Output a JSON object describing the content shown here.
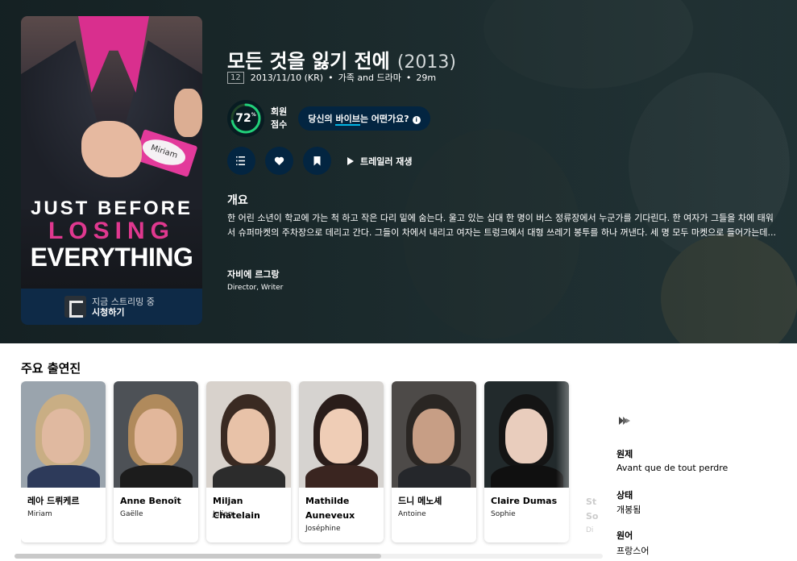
{
  "hero": {
    "title": "모든 것을 잃기 전에",
    "year": "(2013)",
    "certification": "12",
    "release_date": "2013/11/10 (KR)",
    "genres": "가족 and 드라마",
    "runtime": "29m",
    "user_score": "72",
    "user_score_percent": 72,
    "user_score_unit": "%",
    "score_label_line1": "회원",
    "score_label_line2": "점수",
    "vibe_prompt_prefix": "당신의 ",
    "vibe_prompt_highlight": "바이브",
    "vibe_prompt_suffix": "는 어떤가요?",
    "play_trailer": "트레일러 재생",
    "overview_heading": "개요",
    "overview": "한 어린 소년이 학교에 가는 척 하고 작은 다리 밑에 숨는다. 울고 있는 십대 한 명이 버스 정류장에서 누군가를 기다린다. 한 여자가 그들을 차에 태워서 슈퍼마켓의 주차장으로 데리고 간다. 그들이 차에서 내리고 여자는 트렁크에서 대형 쓰레기 봉투를 하나 꺼낸다. 세 명 모두 마켓으로 들어가는데...",
    "crew": {
      "name": "자비에 르그랑",
      "role": "Director, Writer"
    }
  },
  "poster": {
    "title_line1": "JUST BEFORE",
    "title_line2": "LOSING",
    "title_line3": "EVERYTHING",
    "tag_text": "Miriam",
    "streaming_label": "지금 스트리밍 중",
    "watch_label": "시청하기"
  },
  "cast": {
    "heading": "주요 출연진",
    "members": [
      {
        "name": "레아 드뤼케르",
        "character": "Miriam"
      },
      {
        "name": "Anne Benoît",
        "character": "Gaëlle"
      },
      {
        "name": "Miljan Chatelain",
        "character": "Julien"
      },
      {
        "name": "Mathilde Auneveux",
        "character": "Joséphine"
      },
      {
        "name": "드니 메노셰",
        "character": "Antoine"
      },
      {
        "name": "Claire Dumas",
        "character": "Sophie"
      }
    ],
    "peek_name": "St\nSo",
    "peek_character": "Di"
  },
  "facts": {
    "original_title_label": "원제",
    "original_title": "Avant que de tout perdre",
    "status_label": "상태",
    "status": "개봉됨",
    "language_label": "원어",
    "language": "프랑스어"
  },
  "colors": {
    "score_ring": "#21d07a",
    "score_track": "#204529",
    "button_bg": "#032541",
    "accent_underline": "#01b4e4",
    "poster_pink": "#e0388f"
  },
  "icons": {
    "list": "list-icon",
    "favorite": "heart-icon",
    "watchlist": "bookmark-icon",
    "play": "play-icon",
    "info": "info-icon",
    "social": "justwatch-icon"
  }
}
